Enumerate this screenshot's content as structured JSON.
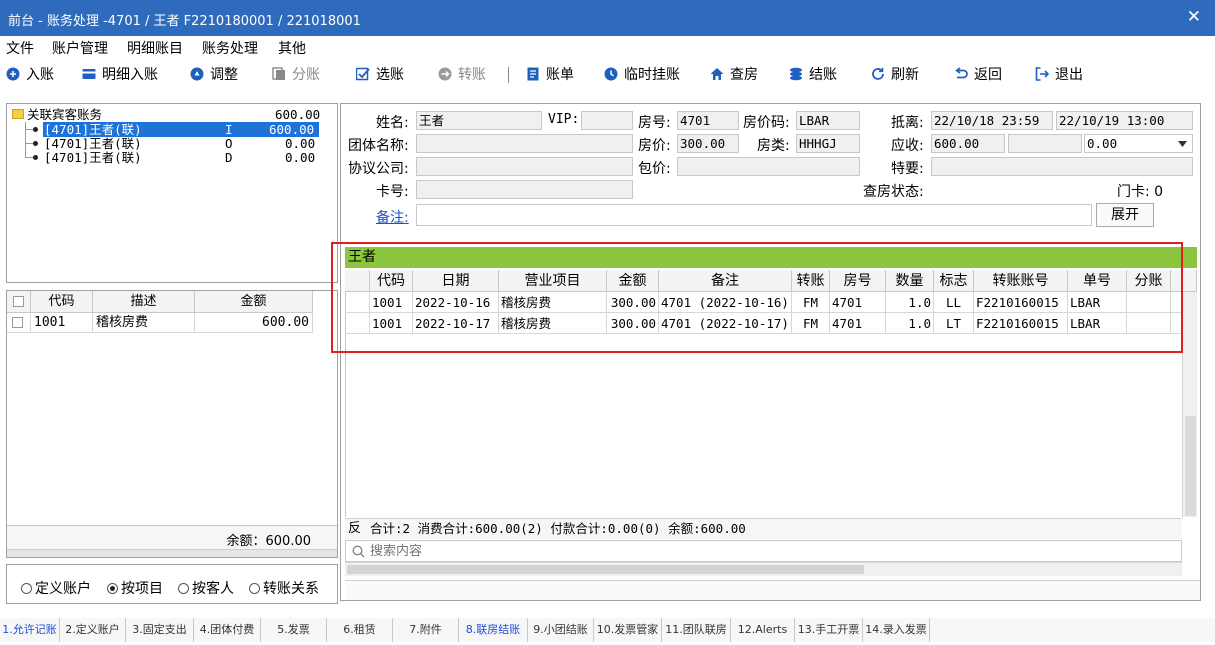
{
  "window": {
    "title": "前台 - 账务处理 -4701 / 王者 F2210180001 / 221018001",
    "close_glyph": "✕"
  },
  "menu": [
    "文件",
    "账户管理",
    "明细账目",
    "账务处理",
    "其他"
  ],
  "toolbar": {
    "items": [
      {
        "label": "入账",
        "icon": "plus-circle-icon",
        "disabled": false
      },
      {
        "label": "明细入账",
        "icon": "card-icon",
        "disabled": false
      },
      {
        "label": "调整",
        "icon": "adjust-circle-icon",
        "disabled": false
      },
      {
        "label": "分账",
        "icon": "split-icon",
        "disabled": true
      },
      {
        "label": "选账",
        "icon": "select-icon",
        "disabled": false
      },
      {
        "label": "转账",
        "icon": "transfer-circle-icon",
        "disabled": true
      },
      {
        "label": "账单",
        "icon": "bill-icon",
        "disabled": false
      },
      {
        "label": "临时挂账",
        "icon": "clock-icon",
        "disabled": false
      },
      {
        "label": "查房",
        "icon": "house-icon",
        "disabled": false
      },
      {
        "label": "结账",
        "icon": "coins-icon",
        "disabled": false
      },
      {
        "label": "刷新",
        "icon": "refresh-icon",
        "disabled": false
      },
      {
        "label": "返回",
        "icon": "back-icon",
        "disabled": false
      },
      {
        "label": "退出",
        "icon": "exit-icon",
        "disabled": false
      }
    ],
    "accent": "#1f5fbf"
  },
  "tree": {
    "root": {
      "label": "关联宾客账务",
      "amount": "600.00"
    },
    "children": [
      {
        "label": "[4701]王者(联)",
        "code": "I",
        "amount": "600.00",
        "selected": true
      },
      {
        "label": "[4701]王者(联)",
        "code": "O",
        "amount": "0.00",
        "selected": false
      },
      {
        "label": "[4701]王者(联)",
        "code": "D",
        "amount": "0.00",
        "selected": false
      }
    ]
  },
  "left_grid": {
    "headers": [
      "代码",
      "描述",
      "金额"
    ],
    "rows": [
      {
        "code": "1001",
        "desc": "稽核房费",
        "amount": "600.00"
      }
    ],
    "balance_label": "余额：600.00"
  },
  "radios": [
    {
      "label": "定义账户",
      "selected": false
    },
    {
      "label": "按项目",
      "selected": true
    },
    {
      "label": "按客人",
      "selected": false
    },
    {
      "label": "转账关系",
      "selected": false
    }
  ],
  "form": {
    "name_label": "姓名:",
    "name_value": "王者",
    "vip_label": "VIP:",
    "vip_value": "",
    "room_no_label": "房号:",
    "room_no_value": "4701",
    "room_rate_code_label": "房价码:",
    "room_rate_code_value": "LBAR",
    "arrive_label": "抵离:",
    "arrive_value": "22/10/18 23:59",
    "depart_value": "22/10/19 13:00",
    "group_label": "团体名称:",
    "group_value": "",
    "rate_label": "房价:",
    "rate_value": "300.00",
    "room_type_label": "房类:",
    "room_type_value": "HHHGJ",
    "receivable_label": "应收:",
    "receivable_value": "600.00",
    "receivable_extra": "",
    "receivable_select": "0.00",
    "company_label": "协议公司:",
    "company_value": "",
    "package_label": "包价:",
    "package_value": "",
    "special_label": "特要:",
    "special_value": "",
    "card_label": "卡号:",
    "card_value": "",
    "checkroom_label": "查房状态:",
    "checkroom_value": "",
    "doorcard_label": "门卡: 0",
    "remark_label": "备注:",
    "remark_value": "",
    "expand_label": "展开"
  },
  "detail": {
    "guest_name": "王者",
    "headers": [
      "代码",
      "日期",
      "营业项目",
      "金额",
      "备注",
      "转账",
      "房号",
      "数量",
      "标志",
      "转账账号",
      "单号",
      "分账"
    ],
    "rows": [
      {
        "code": "1001",
        "date": "2022-10-16",
        "item": "稽核房费",
        "amount": "300.00",
        "remark": "4701 (2022-10-16)",
        "transfer": "FM",
        "room": "4701",
        "qty": "1.0",
        "flag": "LL",
        "account": "F2210160015",
        "bill": "LBAR",
        "split": ""
      },
      {
        "code": "1001",
        "date": "2022-10-17",
        "item": "稽核房费",
        "amount": "300.00",
        "remark": "4701 (2022-10-17)",
        "transfer": "FM",
        "room": "4701",
        "qty": "1.0",
        "flag": "LT",
        "account": "F2210160015",
        "bill": "LBAR",
        "split": ""
      }
    ],
    "summary_reverse": "反",
    "summary": "合计:2  消费合计:600.00(2)  付款合计:0.00(0)  余额:600.00",
    "search_placeholder": "搜索内容",
    "guest_bar_color": "#8cc63f",
    "highlight_color": "#e02020"
  },
  "bottom_tabs": [
    {
      "label": "1.允许记账",
      "active": true
    },
    {
      "label": "2.定义账户",
      "active": false
    },
    {
      "label": "3.固定支出",
      "active": false
    },
    {
      "label": "4.团体付费",
      "active": false
    },
    {
      "label": "5.发票",
      "active": false
    },
    {
      "label": "6.租赁",
      "active": false
    },
    {
      "label": "7.附件",
      "active": false
    },
    {
      "label": "8.联房结账",
      "active": true
    },
    {
      "label": "9.小团结账",
      "active": false
    },
    {
      "label": "10.发票管家",
      "active": false
    },
    {
      "label": "11.团队联房",
      "active": false
    },
    {
      "label": "12.Alerts",
      "active": false
    },
    {
      "label": "13.手工开票",
      "active": false
    },
    {
      "label": "14.录入发票",
      "active": false
    }
  ]
}
